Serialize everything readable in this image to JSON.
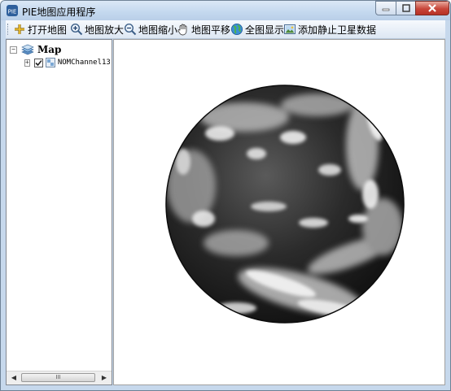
{
  "window": {
    "title": "PIE地图应用程序",
    "controls": [
      "minimize",
      "maximize",
      "close"
    ]
  },
  "toolbar": {
    "buttons": [
      {
        "label": "打开地图",
        "icon": "open-map-icon"
      },
      {
        "label": "地图放大",
        "icon": "zoom-in-icon"
      },
      {
        "label": "地图缩小",
        "icon": "zoom-out-icon"
      },
      {
        "label": "地图平移",
        "icon": "pan-hand-icon"
      },
      {
        "label": "全图显示",
        "icon": "globe-icon"
      },
      {
        "label": "添加静止卫星数据",
        "icon": "satellite-image-icon"
      }
    ]
  },
  "layers_tree": {
    "root": {
      "label": "Map",
      "expanded": true,
      "icon": "map-layers-icon"
    },
    "layers": [
      {
        "label": "NOMChannel13.",
        "checked": true,
        "icon": "raster-layer-icon"
      }
    ],
    "scrollbar": {
      "thumb_glyph": "III"
    }
  },
  "map_view": {
    "content": "full-disk geostationary satellite image, grayscale"
  },
  "colors": {
    "title_bar": "#c5d9ef",
    "close_button": "#c8463a",
    "toolbar": "#e6eef8"
  }
}
